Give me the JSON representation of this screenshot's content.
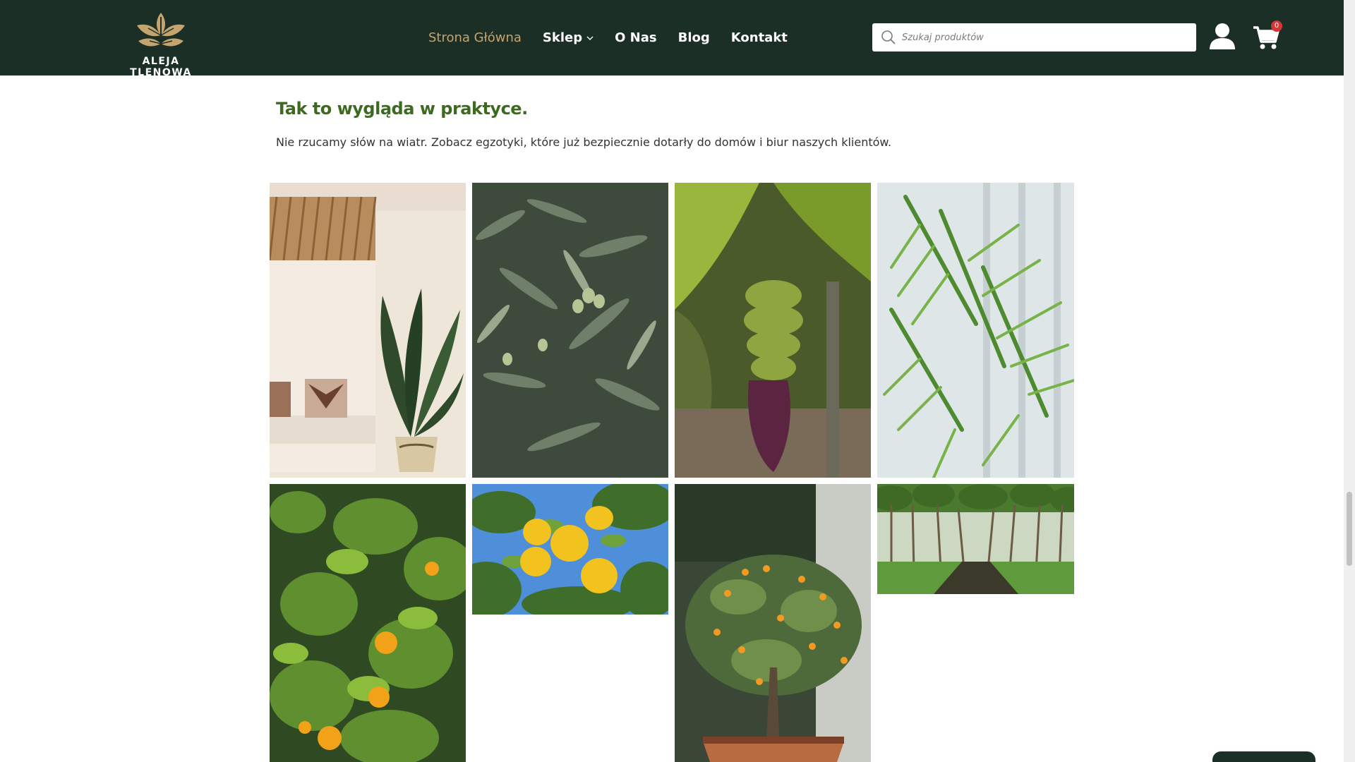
{
  "brand": {
    "name": "ALEJA TLENOWA",
    "icon": "leaf-logo-icon"
  },
  "nav": {
    "items": [
      {
        "label": "Strona Główna",
        "active": true
      },
      {
        "label": "Sklep",
        "has_dropdown": true
      },
      {
        "label": "O Nas"
      },
      {
        "label": "Blog"
      },
      {
        "label": "Kontakt"
      }
    ]
  },
  "search": {
    "placeholder": "Szukaj produktów",
    "value": ""
  },
  "cart": {
    "count": "0"
  },
  "section": {
    "title": "Tak to wygląda w praktyce.",
    "text": "Nie rzucamy słów na wiatr. Zobacz egzotyki, które już bezpiecznie dotarły do domów i biur naszych klientów."
  },
  "gallery": [
    {
      "subject": "strelitzia-interior"
    },
    {
      "subject": "olive-tree"
    },
    {
      "subject": "banana-plant"
    },
    {
      "subject": "palm-leaves"
    },
    {
      "subject": "orange-tree"
    },
    {
      "subject": "lemons"
    },
    {
      "subject": "potted-citrus-tree"
    },
    {
      "subject": "tree-nursery"
    }
  ],
  "colors": {
    "header_bg": "#1c2f26",
    "active_nav": "#c5a46d",
    "title_green": "#3c6b1f",
    "badge": "#d63638"
  }
}
